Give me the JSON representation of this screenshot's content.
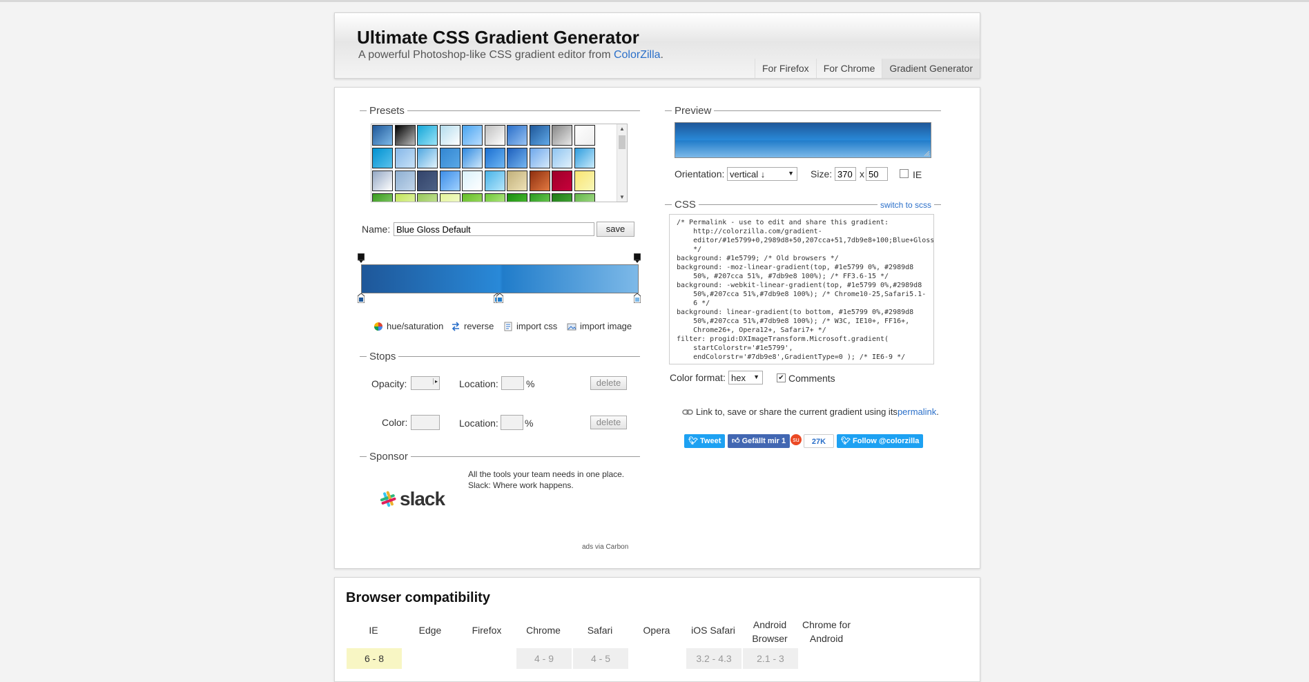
{
  "header": {
    "title": "Ultimate CSS Gradient Generator",
    "subtitle_prefix": "A powerful Photoshop-like CSS gradient editor from ",
    "subtitle_link": "ColorZilla",
    "subtitle_suffix": ".",
    "nav": [
      "For Firefox",
      "For Chrome",
      "Gradient Generator"
    ]
  },
  "presets": {
    "legend": "Presets",
    "swatches": [
      [
        "#1e5799",
        "#7db9e8"
      ],
      [
        "#000000",
        "#bbbbbb"
      ],
      [
        "#14a6d8",
        "#9be4f7"
      ],
      [
        "#b3dced",
        "#ffffff"
      ],
      [
        "#49a5f0",
        "#b9ddff"
      ],
      [
        "#c0c0c0",
        "#ffffff"
      ],
      [
        "#2a6fc9",
        "#97c2f3"
      ],
      [
        "#1e5799",
        "#61a9e8"
      ],
      [
        "#888888",
        "#e8e8e8"
      ],
      [
        "#ffffff",
        "#eeeeee"
      ],
      [
        "#0091d1",
        "#5bc2ec"
      ],
      [
        "#86b7e8",
        "#c8e2f8"
      ],
      [
        "#4fa7e0",
        "#e3f3fc"
      ],
      [
        "#3286d2",
        "#5aa8e6"
      ],
      [
        "#2f8ae0",
        "#cfe8fb"
      ],
      [
        "#1b6fd1",
        "#6fb7f4"
      ],
      [
        "#1d5fbd",
        "#75b6f0"
      ],
      [
        "#6fa8ec",
        "#d5e9fb"
      ],
      [
        "#8ec4f0",
        "#e2f1fc"
      ],
      [
        "#2e9dde",
        "#c9eafb"
      ],
      [
        "#93a7c4",
        "#ffffff"
      ],
      [
        "#8eafd2",
        "#c2d6eb"
      ],
      [
        "#33446b",
        "#4d6185"
      ],
      [
        "#3d8ee8",
        "#9fd0ff"
      ],
      [
        "#d9f1fb",
        "#ffffff"
      ],
      [
        "#48b3e8",
        "#b7e6fb"
      ],
      [
        "#c1b07b",
        "#eee1b6"
      ],
      [
        "#8e2f0f",
        "#e27941"
      ],
      [
        "#9e0029",
        "#c7003b"
      ],
      [
        "#fae472",
        "#f8f7b8"
      ],
      [
        "#3a9c1e",
        "#93d17a"
      ],
      [
        "#c1e55b",
        "#e8f6b8"
      ],
      [
        "#98c75c",
        "#cde8a1"
      ],
      [
        "#e3f49c",
        "#f5fbd5"
      ],
      [
        "#66be2a",
        "#a9e06f"
      ],
      [
        "#6fc93a",
        "#c7ee98"
      ],
      [
        "#1b8f11",
        "#54c338"
      ],
      [
        "#2c9b22",
        "#7bd25c"
      ],
      [
        "#1e7c18",
        "#4fb03e"
      ],
      [
        "#65b84b",
        "#b1e095"
      ]
    ]
  },
  "name": {
    "label": "Name:",
    "value": "Blue Gloss Default",
    "save": "save"
  },
  "tools": {
    "hue": "hue/saturation",
    "reverse": "reverse",
    "import_css": "import css",
    "import_image": "import image"
  },
  "stops": {
    "legend": "Stops",
    "opacity_label": "Opacity:",
    "location_label": "Location:",
    "percent": "%",
    "color_label": "Color:",
    "delete": "delete"
  },
  "sponsor": {
    "legend": "Sponsor",
    "text1": "All the tools your team needs in one place.",
    "text2": "Slack: Where work happens.",
    "logo_text": "slack",
    "ads": "ads via Carbon"
  },
  "preview": {
    "legend": "Preview",
    "orientation_label": "Orientation:",
    "orientation_value": "vertical ↓",
    "size_label": "Size:",
    "width": "370",
    "x": "x",
    "height": "50",
    "ie": "IE"
  },
  "css": {
    "legend": "CSS",
    "switch": "switch to scss",
    "lines": [
      "/* Permalink - use to edit and share this gradient:",
      "    http://colorzilla.com/gradient-",
      "    editor/#1e5799+0,2989d8+50,207cca+51,7db9e8+100;Blue+Gloss",
      "    */",
      "background: #1e5799; /* Old browsers */",
      "background: -moz-linear-gradient(top, #1e5799 0%, #2989d8",
      "    50%, #207cca 51%, #7db9e8 100%); /* FF3.6-15 */",
      "background: -webkit-linear-gradient(top, #1e5799 0%,#2989d8",
      "    50%,#207cca 51%,#7db9e8 100%); /* Chrome10-25,Safari5.1-",
      "    6 */",
      "background: linear-gradient(to bottom, #1e5799 0%,#2989d8",
      "    50%,#207cca 51%,#7db9e8 100%); /* W3C, IE10+, FF16+,",
      "    Chrome26+, Opera12+, Safari7+ */",
      "filter: progid:DXImageTransform.Microsoft.gradient(",
      "    startColorstr='#1e5799',",
      "    endColorstr='#7db9e8',GradientType=0 ); /* IE6-9 */"
    ],
    "format_label": "Color format:",
    "format_value": "hex",
    "comments": "Comments"
  },
  "link": {
    "prefix": "Link to, save or share the current gradient using its ",
    "link": "permalink",
    "suffix": "."
  },
  "social": {
    "tweet": "Tweet",
    "like": "Gefällt mir 1",
    "stumble": "27K",
    "follow": "Follow @colorzilla"
  },
  "compat": {
    "title": "Browser compatibility",
    "headers": [
      "IE",
      "Edge",
      "Firefox",
      "Chrome",
      "Safari",
      "Opera",
      "iOS Safari",
      "Android Browser",
      "Chrome for Android"
    ],
    "row1": [
      "6 - 8",
      "",
      "",
      "4 - 9",
      "4 - 5",
      "",
      "3.2 - 4.3",
      "2.1 - 3",
      ""
    ]
  },
  "colors": {
    "gradient": [
      "#1e5799",
      "#2989d8",
      "#207cca",
      "#7db9e8"
    ],
    "twitter": "#1da1f2",
    "facebook": "#4267b2",
    "stumble": "#eb4924"
  }
}
